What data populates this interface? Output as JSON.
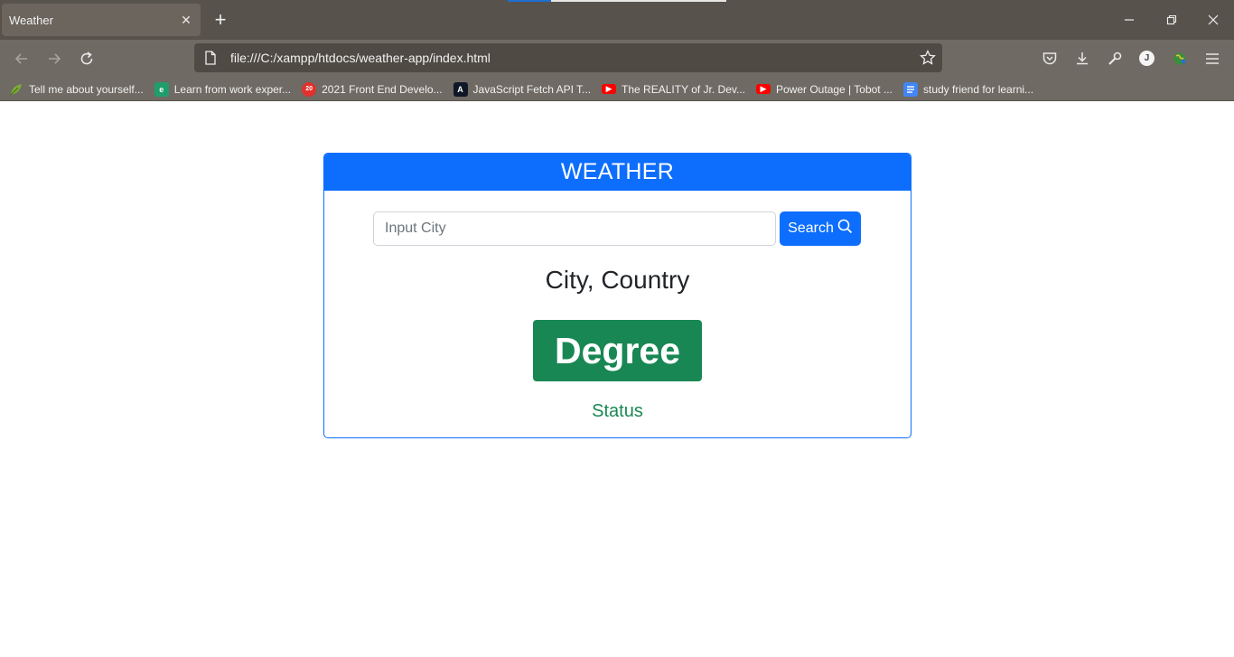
{
  "browser": {
    "tab_title": "Weather",
    "url": "file:///C:/xampp/htdocs/weather-app/index.html",
    "profile_initial": "J",
    "bookmarks": [
      {
        "label": "Tell me about yourself...",
        "icon": "leaf-icon"
      },
      {
        "label": "Learn from work exper...",
        "icon": "e-icon"
      },
      {
        "label": "2021 Front End Develo...",
        "icon": "red-circle-icon"
      },
      {
        "label": "JavaScript Fetch API T...",
        "icon": "a-icon"
      },
      {
        "label": "The REALITY of Jr. Dev...",
        "icon": "youtube-icon"
      },
      {
        "label": "Power Outage | Tobot ...",
        "icon": "youtube-icon"
      },
      {
        "label": "study friend for learni...",
        "icon": "docs-icon"
      }
    ]
  },
  "app": {
    "header": "WEATHER",
    "search_placeholder": "Input City",
    "search_value": "",
    "search_button": "Search",
    "location": "City, Country",
    "degree": "Degree",
    "status": "Status"
  },
  "colors": {
    "primary": "#0d6efd",
    "success": "#198754"
  }
}
